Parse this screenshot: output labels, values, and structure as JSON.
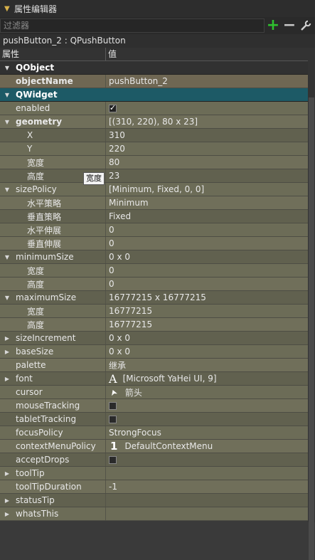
{
  "title": "属性编辑器",
  "filter": {
    "placeholder": "过滤器",
    "value": ""
  },
  "object_label": "pushButton_2 : QPushButton",
  "header": {
    "property": "属性",
    "value": "值"
  },
  "rows": [
    {
      "label": "QObject",
      "value": "",
      "kind": "group",
      "expanded": true
    },
    {
      "label": "objectName",
      "value": "pushButton_2",
      "kind": "objname",
      "bold": true
    },
    {
      "label": "QWidget",
      "value": "",
      "kind": "group-sel",
      "expanded": true
    },
    {
      "label": "enabled",
      "value": "✓",
      "kind": "checkbox",
      "checked": true
    },
    {
      "label": "geometry",
      "value": "[(310, 220), 80 x 23]",
      "kind": "parent",
      "bold": true,
      "expanded": true
    },
    {
      "label": "X",
      "value": "310",
      "kind": "child"
    },
    {
      "label": "Y",
      "value": "220",
      "kind": "child"
    },
    {
      "label": "宽度",
      "value": "80",
      "kind": "child"
    },
    {
      "label": "高度",
      "value": "23",
      "kind": "child"
    },
    {
      "label": "sizePolicy",
      "value": "[Minimum, Fixed, 0, 0]",
      "kind": "parent",
      "expanded": true
    },
    {
      "label": "水平策略",
      "value": "Minimum",
      "kind": "child"
    },
    {
      "label": "垂直策略",
      "value": "Fixed",
      "kind": "child"
    },
    {
      "label": "水平伸展",
      "value": "0",
      "kind": "child"
    },
    {
      "label": "垂直伸展",
      "value": "0",
      "kind": "child"
    },
    {
      "label": "minimumSize",
      "value": "0 x 0",
      "kind": "parent",
      "expanded": true
    },
    {
      "label": "宽度",
      "value": "0",
      "kind": "child"
    },
    {
      "label": "高度",
      "value": "0",
      "kind": "child"
    },
    {
      "label": "maximumSize",
      "value": "16777215 x 16777215",
      "kind": "parent",
      "expanded": true
    },
    {
      "label": "宽度",
      "value": "16777215",
      "kind": "child"
    },
    {
      "label": "高度",
      "value": "16777215",
      "kind": "child"
    },
    {
      "label": "sizeIncrement",
      "value": "0 x 0",
      "kind": "parent",
      "expanded": false
    },
    {
      "label": "baseSize",
      "value": "0 x 0",
      "kind": "parent",
      "expanded": false
    },
    {
      "label": "palette",
      "value": "继承",
      "kind": "plain"
    },
    {
      "label": "font",
      "value": "[Microsoft YaHei UI, 9]",
      "kind": "parent-icon",
      "icon": "font-icon",
      "glyph": "A",
      "expanded": false
    },
    {
      "label": "cursor",
      "value": "箭头",
      "kind": "icon",
      "icon": "cursor-arrow-icon",
      "glyph": "➤"
    },
    {
      "label": "mouseTracking",
      "value": "",
      "kind": "checkbox",
      "checked": false
    },
    {
      "label": "tabletTracking",
      "value": "",
      "kind": "checkbox",
      "checked": false
    },
    {
      "label": "focusPolicy",
      "value": "StrongFocus",
      "kind": "plain"
    },
    {
      "label": "contextMenuPolicy",
      "value": "DefaultContextMenu",
      "kind": "icon",
      "icon": "context-menu-icon",
      "glyph": "1"
    },
    {
      "label": "acceptDrops",
      "value": "",
      "kind": "checkbox",
      "checked": false
    },
    {
      "label": "toolTip",
      "value": "",
      "kind": "parent",
      "expanded": false
    },
    {
      "label": "toolTipDuration",
      "value": "-1",
      "kind": "plain"
    },
    {
      "label": "statusTip",
      "value": "",
      "kind": "parent",
      "expanded": false
    },
    {
      "label": "whatsThis",
      "value": "",
      "kind": "parent",
      "expanded": false
    }
  ],
  "tooltip": "宽度",
  "colors": {
    "accent_add": "#2fc12f",
    "selected_group": "#1d5a66",
    "row_olive": "#6c6c57"
  }
}
